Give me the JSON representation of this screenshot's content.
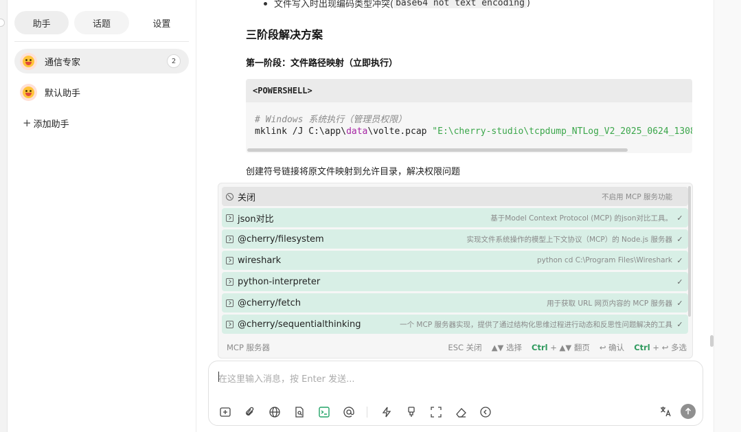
{
  "sidebar": {
    "tabs": [
      {
        "label": "助手"
      },
      {
        "label": "话题"
      },
      {
        "label": "设置"
      }
    ],
    "assistants": [
      {
        "name": "通信专家",
        "count": "2"
      },
      {
        "name": "默认助手"
      }
    ],
    "add_label": "添加助手"
  },
  "main": {
    "top_line_text": "文件写入时出现编码类型冲突(",
    "top_line_code": "base64 not text encoding",
    "top_line_end": ")",
    "heading": "三阶段解决方案",
    "phase1": "第一阶段：文件路径映射（立即执行）",
    "code": {
      "lang": "<POWERSHELL>",
      "comment": "# Windows 系统执行（管理员权限）",
      "cmd_prefix": "mklink /J C:\\app\\",
      "cmd_keyword": "data",
      "cmd_mid": "\\volte.pcap ",
      "cmd_string": "\"E:\\cherry-studio\\tcpdump_NTLog_V2_2025_0624_130818"
    },
    "paragraph": "创建符号链接将原文件映射到允许目录，解决权限问题"
  },
  "mcp": {
    "items": [
      {
        "name": "关闭",
        "desc": "不启用 MCP 服务功能",
        "checked": false,
        "off": true
      },
      {
        "name": "json对比",
        "desc": "基于Model Context Protocol (MCP) 的json对比工具。",
        "checked": true
      },
      {
        "name": "@cherry/filesystem",
        "desc": "实现文件系统操作的模型上下文协议（MCP）的 Node.js 服务器",
        "checked": true
      },
      {
        "name": "wireshark",
        "desc": "python cd C:\\Program Files\\Wireshark",
        "checked": true
      },
      {
        "name": "python-interpreter",
        "desc": "",
        "checked": true
      },
      {
        "name": "@cherry/fetch",
        "desc": "用于获取 URL 网页内容的 MCP 服务器",
        "checked": true
      },
      {
        "name": "@cherry/sequentialthinking",
        "desc": "一个 MCP 服务器实现，提供了通过结构化思维过程进行动态和反思性问题解决的工具",
        "checked": true
      }
    ],
    "footer_title": "MCP 服务器",
    "hint_esc": "ESC 关闭",
    "hint_select": "▲▼ 选择",
    "hint_page_key": "Ctrl",
    "hint_page": "+ ▲▼ 翻页",
    "hint_confirm": "↩ 确认",
    "hint_multi_key": "Ctrl",
    "hint_multi": "+ ↩ 多选"
  },
  "input": {
    "placeholder": "在这里输入消息，按 Enter 发送..."
  },
  "icons": {
    "toolbar": [
      "new-topic-icon",
      "attachment-icon",
      "web-search-icon",
      "knowledge-base-icon",
      "mcp-server-icon",
      "mention-model-icon",
      "quick-phrase-icon",
      "clear-icon",
      "expand-icon",
      "eraser-icon",
      "collapse-icon"
    ],
    "translate": "translate-icon",
    "send": "send-arrow-icon"
  },
  "colors": {
    "accent": "#21a366",
    "mcp_row_bg": "#d8efe6"
  }
}
